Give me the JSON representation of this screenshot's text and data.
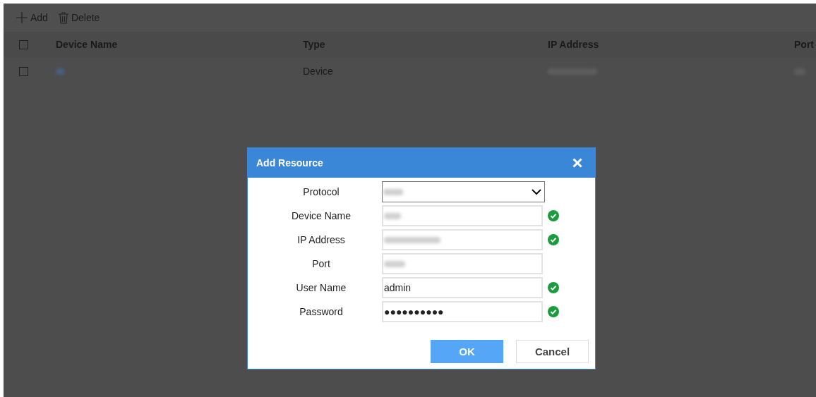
{
  "toolbar": [
    {
      "kind": "add",
      "label": "Add"
    },
    {
      "kind": "delete",
      "label": "Delete"
    }
  ],
  "table": {
    "columns": [
      "Device Name",
      "Type",
      "IP Address",
      "Port"
    ],
    "all_checked": false,
    "rows": [
      {
        "checked": false,
        "type": "Device"
      }
    ]
  },
  "dialog": {
    "title": "Add Resource",
    "fields": [
      {
        "kind": "select",
        "label": "Protocol"
      },
      {
        "kind": "text",
        "label": "Device Name",
        "valid": true
      },
      {
        "kind": "text",
        "label": "IP Address",
        "valid": true
      },
      {
        "kind": "text",
        "label": "Port",
        "valid": false
      },
      {
        "kind": "text",
        "label": "User Name",
        "value": "admin",
        "valid": true
      },
      {
        "kind": "text",
        "label": "Password",
        "value": "●●●●●●●●●●",
        "valid": true
      }
    ],
    "buttons": [
      {
        "kind": "primary",
        "label": "OK"
      },
      {
        "kind": "secondary",
        "label": "Cancel"
      }
    ]
  }
}
